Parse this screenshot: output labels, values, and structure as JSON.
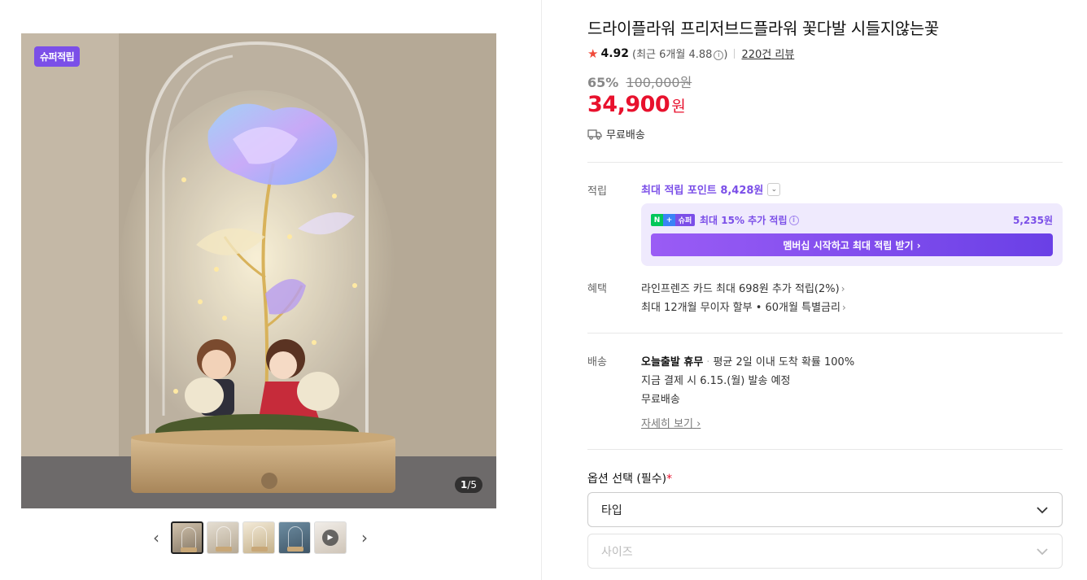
{
  "gallery": {
    "badge": "슈퍼적립",
    "counter_current": "1",
    "counter_total": "/5",
    "thumbnails": [
      "image-1",
      "image-2",
      "image-3",
      "image-4",
      "video"
    ]
  },
  "product": {
    "title": "드라이플라워 프리저브드플라워 꽃다발 시들지않는꽃",
    "rating": "4.92",
    "recent_rating": "(최근 6개월 4.88",
    "recent_rating_close": ")",
    "review_count": "220건 리뷰",
    "discount": "65%",
    "original_price": "100,000원",
    "price": "34,900",
    "currency": "원",
    "shipping": "무료배송"
  },
  "points": {
    "label": "적립",
    "max_points_text": "최대 적립 포인트",
    "max_points": "8,428원",
    "badge_n": "N",
    "badge_plus": "+",
    "badge_super": "슈퍼",
    "extra_text": "최대 15% 추가 적립",
    "extra_amount": "5,235원",
    "cta": "멤버십 시작하고 최대 적립 받기"
  },
  "benefits": {
    "label": "혜택",
    "items": [
      "라인프렌즈 카드 최대 698원 추가 적립(2%)",
      "최대 12개월 무이자 할부 • 60개월 특별금리"
    ]
  },
  "delivery": {
    "label": "배송",
    "today": "오늘출발 휴무",
    "arrival": "평균 2일 이내 도착 확률 100%",
    "schedule": "지금 결제 시 6.15.(월) 발송 예정",
    "fee": "무료배송",
    "detail_link": "자세히 보기"
  },
  "options": {
    "title": "옵션 선택 (필수)",
    "required_mark": "*",
    "select1": "타입",
    "select2": "사이즈"
  },
  "colors": {
    "accent": "#7b4fe8",
    "price_red": "#e8112d",
    "star": "#f04a3a"
  }
}
